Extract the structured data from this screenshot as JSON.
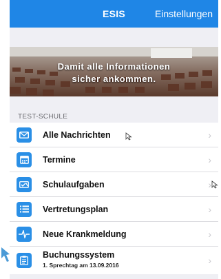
{
  "nav": {
    "title": "ESIS",
    "settings_label": "Einstellungen"
  },
  "banner": {
    "line1": "Damit alle Informationen",
    "line2": "sicher ankommen."
  },
  "section": {
    "title": "TEST-SCHULE"
  },
  "items": [
    {
      "label": "Alle Nachrichten",
      "icon": "envelope-icon"
    },
    {
      "label": "Termine",
      "icon": "calendar-icon"
    },
    {
      "label": "Schulaufgaben",
      "icon": "homework-icon"
    },
    {
      "label": "Vertretungsplan",
      "icon": "list-icon"
    },
    {
      "label": "Neue Krankmeldung",
      "icon": "heartbeat-icon"
    },
    {
      "label": "Buchungssystem",
      "sub": "1. Sprechtag am 13.09.2016",
      "icon": "clipboard-icon"
    }
  ],
  "colors": {
    "nav": "#1f86e6",
    "icon_bg": "#2a8fe6",
    "chevron": "#c7c7cc"
  }
}
